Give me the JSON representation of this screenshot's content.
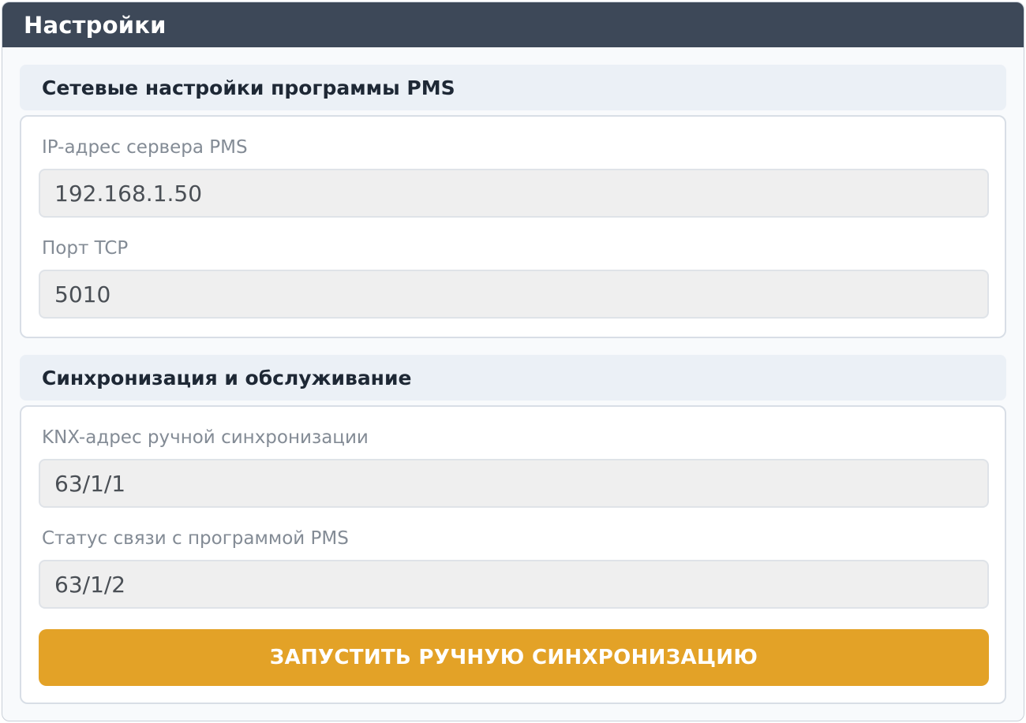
{
  "window": {
    "title": "Настройки"
  },
  "network_section": {
    "header": "Сетевые настройки программы PMS",
    "ip_label": "IP-адрес сервера PMS",
    "ip_value": "192.168.1.50",
    "port_label": "Порт TCP",
    "port_value": "5010"
  },
  "sync_section": {
    "header": "Синхронизация и обслуживание",
    "knx_label": "KNX-адрес ручной синхронизации",
    "knx_value": "63/1/1",
    "status_label": "Статус связи с программой PMS",
    "status_value": "63/1/2",
    "sync_button_label": "ЗАПУСТИТЬ РУЧНУЮ СИНХРОНИЗАЦИЮ"
  },
  "colors": {
    "titlebar": "#3d4858",
    "accent_button": "#e3a227",
    "section_header_bg": "#ebf0f6"
  }
}
